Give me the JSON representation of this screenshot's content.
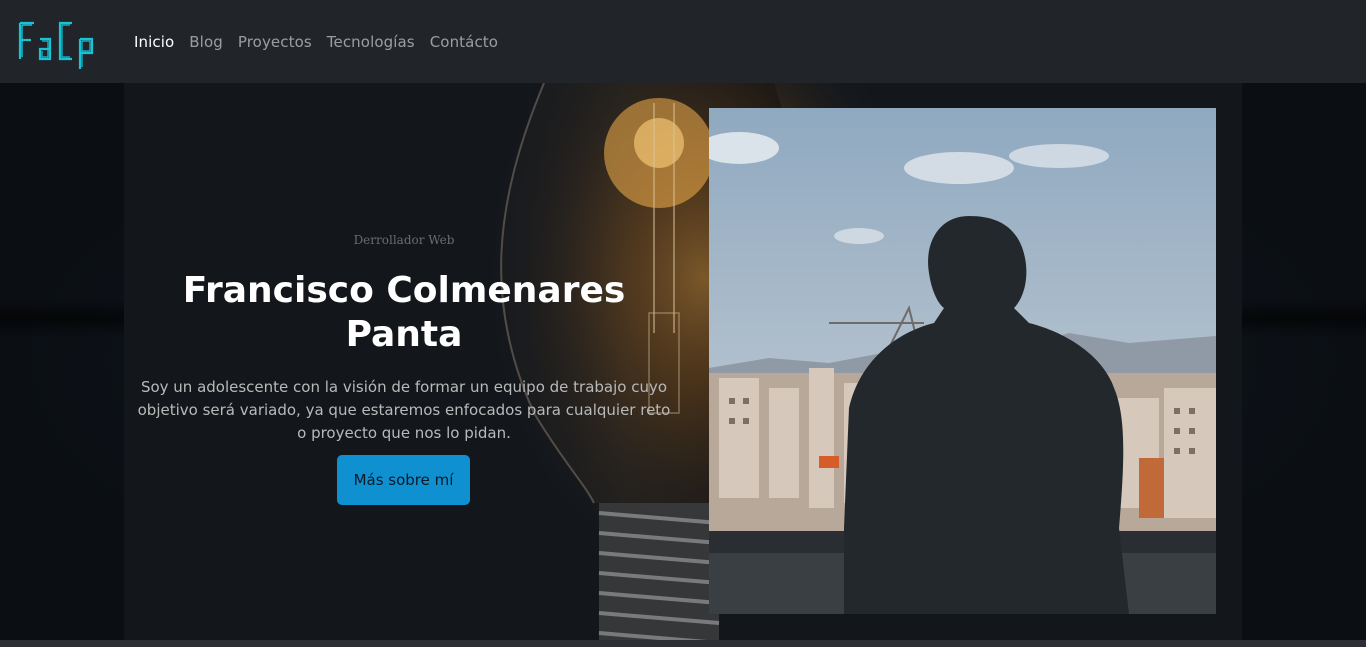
{
  "brand": {
    "logo_text": "FaCp",
    "accent": "#19c2d4"
  },
  "nav": {
    "items": [
      {
        "label": "Inicio",
        "active": true
      },
      {
        "label": "Blog",
        "active": false
      },
      {
        "label": "Proyectos",
        "active": false
      },
      {
        "label": "Tecnologías",
        "active": false
      },
      {
        "label": "Contácto",
        "active": false
      }
    ]
  },
  "hero": {
    "subtitle": "Derrollador Web",
    "title": "Francisco Colmenares Panta",
    "description": "Soy un adolescente con la visión de formar un equipo de trabajo cuyo objetivo será variado, ya que estaremos enfocados para cualquier reto o proyecto que nos lo pidan.",
    "button_label": "Más sobre mí",
    "button_color": "#0f90d1"
  }
}
